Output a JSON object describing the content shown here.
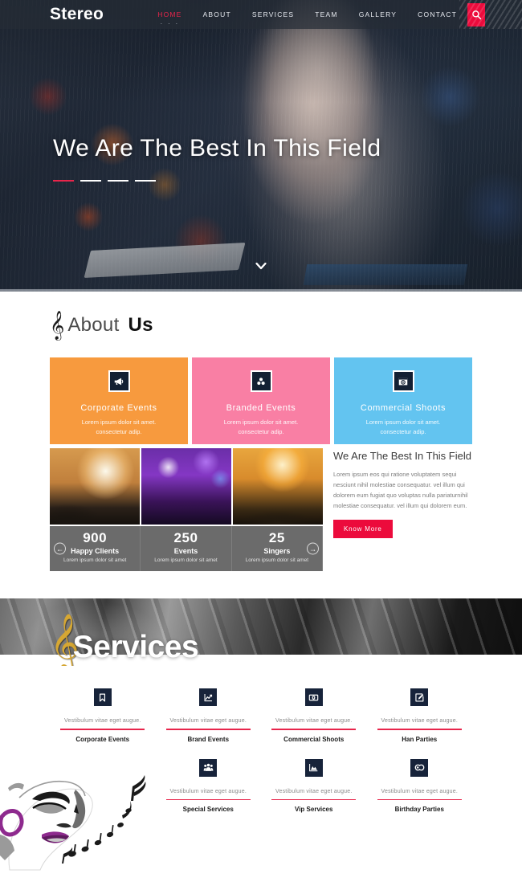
{
  "navbar": {
    "brand": "Stereo",
    "links": [
      {
        "label": "HOME",
        "active": true
      },
      {
        "label": "ABOUT",
        "active": false
      },
      {
        "label": "SERVICES",
        "active": false
      },
      {
        "label": "TEAM",
        "active": false
      },
      {
        "label": "GALLERY",
        "active": false
      },
      {
        "label": "CONTACT",
        "active": false
      }
    ],
    "dots": "· · ·",
    "search_icon": "search-icon",
    "accent_color": "#ec0b3c"
  },
  "hero": {
    "title": "We Are The Best In This Field",
    "scroll_icon": "chevron-down-icon",
    "dash_accent_color": "#e8254b",
    "image_alt": "dj-performing-at-mixing-desk"
  },
  "about": {
    "heading_icon": "treble-clef-icon",
    "heading_light": "About",
    "heading_bold": "Us",
    "cards": [
      {
        "title": "Corporate Events",
        "desc": "Lorem ipsum dolor sit amet. consectetur adip.",
        "color": "#f79a3e",
        "icon": "megaphone-icon"
      },
      {
        "title": "Branded Events",
        "desc": "Lorem ipsum dolor sit amet. consectetur adip.",
        "color": "#f97fa4",
        "icon": "cubes-icon"
      },
      {
        "title": "Commercial Shoots",
        "desc": "Lorem ipsum dolor sit amet. consectetur adip.",
        "color": "#63c4f0",
        "icon": "photo-frame-icon"
      }
    ],
    "gallery": [
      {
        "alt": "crowd-with-raised-hands"
      },
      {
        "alt": "phone-filming-purple-stage"
      },
      {
        "alt": "audience-at-orange-lit-concert"
      }
    ],
    "stats": {
      "prev_icon": "arrow-left-icon",
      "next_icon": "arrow-right-icon",
      "items": [
        {
          "number": "900",
          "label": "Happy Clients",
          "sub": "Lorem ipsum dolor sit amet"
        },
        {
          "number": "250",
          "label": "Events",
          "sub": "Lorem ipsum dolor sit amet"
        },
        {
          "number": "25",
          "label": "Singers",
          "sub": "Lorem ipsum dolor sit amet"
        }
      ]
    },
    "panel": {
      "title": "We Are The Best In This Field",
      "body": "Lorem ipsum eos qui ratione voluptatem sequi nesciunt nihil molestiae consequatur. vel illum qui dolorem eum fugiat quo voluptas nulla pariaturnihil molestiae consequatur. vel illum qui dolorem eum.",
      "button": "Know More"
    }
  },
  "services": {
    "heading_icon": "treble-clef-gold-icon",
    "heading": "Services",
    "banner_alt": "guitar-tuning-pegs-grayscale",
    "face_art_alt": "woman-singing-line-art-with-music-notes",
    "row1": [
      {
        "icon": "bookmark-icon",
        "caption": "Vestibulum vitae eget augue.",
        "name": "Corporate Events"
      },
      {
        "icon": "line-chart-icon",
        "caption": "Vestibulum vitae eget augue.",
        "name": "Brand Events"
      },
      {
        "icon": "camera-lens-icon",
        "caption": "Vestibulum vitae eget augue.",
        "name": "Commercial Shoots"
      },
      {
        "icon": "pencil-square-icon",
        "caption": "Vestibulum vitae eget augue.",
        "name": "Han Parties"
      }
    ],
    "row2": [
      {
        "icon": "blank",
        "caption": "",
        "name": ""
      },
      {
        "icon": "users-group-icon",
        "caption": "Vestibulum vitae eget augue.",
        "name": "Special Services"
      },
      {
        "icon": "mountain-image-icon",
        "caption": "Vestibulum vitae eget augue.",
        "name": "Vip Services"
      },
      {
        "icon": "handshake-icon",
        "caption": "Vestibulum vitae eget augue.",
        "name": "Birthday Parties"
      }
    ],
    "rule_color": "#e8254b"
  }
}
